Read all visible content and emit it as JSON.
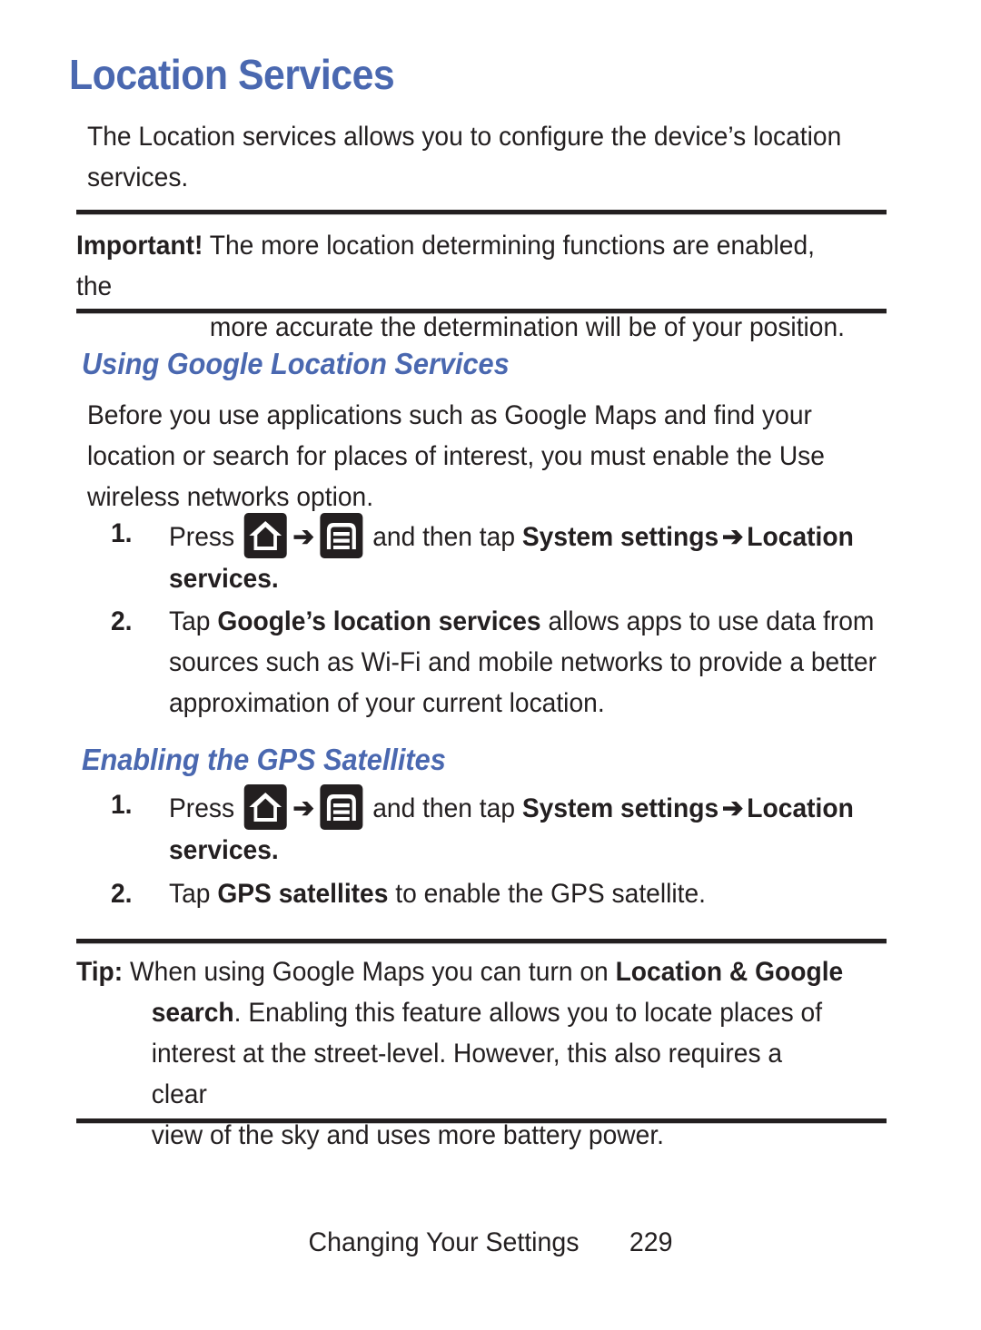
{
  "document": {
    "title": "Location Services",
    "intro": "The Location services allows you to configure the device’s location services.",
    "important": {
      "label": "Important!",
      "line1": "The more location determining functions are enabled, the",
      "line2": "more accurate the determination will be of your position."
    },
    "section_google": {
      "heading": "Using Google Location Services",
      "intro": "Before you use applications such as Google Maps and find your location or search for places of interest, you must enable the Use wireless networks option.",
      "steps": [
        {
          "number": "1.",
          "pre": "Press",
          "icon1": "home-icon",
          "arrow1": "➔",
          "icon2": "menu-icon",
          "mid": "and then tap",
          "bold1": "System settings",
          "arrow2": "➔",
          "bold2": "Location services",
          "end": "."
        },
        {
          "number": "2.",
          "pre": "Tap",
          "bold1": "Google’s location services",
          "post": "allows apps to use data from sources such as Wi-Fi and mobile networks to provide a better approximation of your current location."
        }
      ]
    },
    "section_gps": {
      "heading": "Enabling the GPS Satellites",
      "steps": [
        {
          "number": "1.",
          "pre": "Press",
          "icon1": "home-icon",
          "arrow1": "➔",
          "icon2": "menu-icon",
          "mid": "and then tap",
          "bold1": "System settings",
          "arrow2": "➔",
          "bold2": "Location services",
          "end": "."
        },
        {
          "number": "2.",
          "pre": "Tap",
          "bold1": "GPS satellites",
          "post": "to enable the GPS satellite."
        }
      ]
    },
    "tip": {
      "label": "Tip:",
      "line1_a": "When using Google Maps you can turn on",
      "line1_b": "Location & Google",
      "line2_a": "search",
      "line2_b": ". Enabling this feature allows you to locate places of",
      "line3": "interest at the street-level. However, this also requires a clear",
      "line4": "view of the sky and uses more battery power."
    },
    "footer": {
      "chapter": "Changing Your Settings",
      "page_number": "229"
    },
    "colors": {
      "heading_blue": "#4a68b0",
      "text_black": "#231f20",
      "rule_black": "#231f20"
    }
  }
}
